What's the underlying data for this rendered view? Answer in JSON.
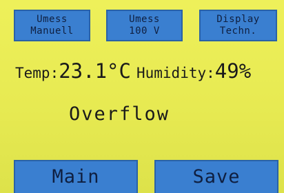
{
  "top_buttons": {
    "umess_manuell": {
      "line1": "Umess",
      "line2": "Manuell"
    },
    "umess_100v": {
      "line1": "Umess",
      "line2": "100 V"
    },
    "display_techn": {
      "line1": "Display",
      "line2": "Techn."
    }
  },
  "readings": {
    "temp_label": "Temp:",
    "temp_value": "23.1°C",
    "humidity_label": "Humidity:",
    "humidity_value": "49%"
  },
  "status": {
    "message": "Overflow"
  },
  "bottom_buttons": {
    "main_label": "Main",
    "save_label": "Save"
  },
  "colors": {
    "screen_background": "#e7ea52",
    "button_fill": "#3a7fd0",
    "button_border": "#2a62a6",
    "text": "#1a1a1a"
  }
}
